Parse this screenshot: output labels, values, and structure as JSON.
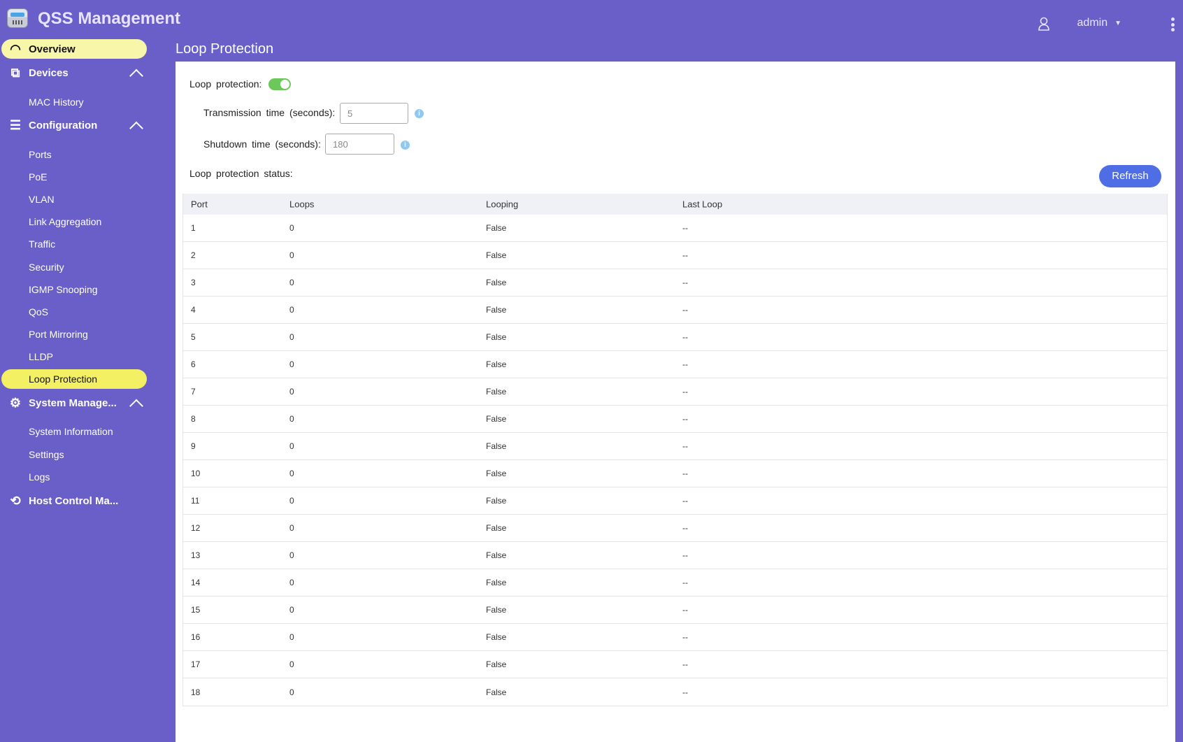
{
  "header": {
    "app_title": "QSS Management",
    "user": "admin"
  },
  "sidebar": {
    "overview": "Overview",
    "devices": "Devices",
    "mac_history": "MAC History",
    "configuration": "Configuration",
    "config_items": [
      "Ports",
      "PoE",
      "VLAN",
      "Link Aggregation",
      "Traffic",
      "Security",
      "IGMP Snooping",
      "QoS",
      "Port Mirroring",
      "LLDP",
      "Loop Protection"
    ],
    "system_management": "System Manage...",
    "system_items": [
      "System Information",
      "Settings",
      "Logs"
    ],
    "host_control": "Host Control Ma..."
  },
  "page": {
    "title": "Loop Protection",
    "loop_protection_label": "Loop protection:",
    "loop_protection_enabled": true,
    "transmission_label": "Transmission time (seconds):",
    "transmission_value": "5",
    "shutdown_label": "Shutdown time (seconds):",
    "shutdown_value": "180",
    "status_label": "Loop protection status:",
    "refresh_label": "Refresh"
  },
  "table": {
    "columns": [
      "Port",
      "Loops",
      "Looping",
      "Last Loop"
    ],
    "rows": [
      [
        "1",
        "0",
        "False",
        "--"
      ],
      [
        "2",
        "0",
        "False",
        "--"
      ],
      [
        "3",
        "0",
        "False",
        "--"
      ],
      [
        "4",
        "0",
        "False",
        "--"
      ],
      [
        "5",
        "0",
        "False",
        "--"
      ],
      [
        "6",
        "0",
        "False",
        "--"
      ],
      [
        "7",
        "0",
        "False",
        "--"
      ],
      [
        "8",
        "0",
        "False",
        "--"
      ],
      [
        "9",
        "0",
        "False",
        "--"
      ],
      [
        "10",
        "0",
        "False",
        "--"
      ],
      [
        "11",
        "0",
        "False",
        "--"
      ],
      [
        "12",
        "0",
        "False",
        "--"
      ],
      [
        "13",
        "0",
        "False",
        "--"
      ],
      [
        "14",
        "0",
        "False",
        "--"
      ],
      [
        "15",
        "0",
        "False",
        "--"
      ],
      [
        "16",
        "0",
        "False",
        "--"
      ],
      [
        "17",
        "0",
        "False",
        "--"
      ],
      [
        "18",
        "0",
        "False",
        "--"
      ]
    ]
  },
  "colors": {
    "brand": "#6a5fc9",
    "active_nav": "#f4f064",
    "toggle_on": "#6cc85a",
    "button": "#4f6ee6"
  }
}
